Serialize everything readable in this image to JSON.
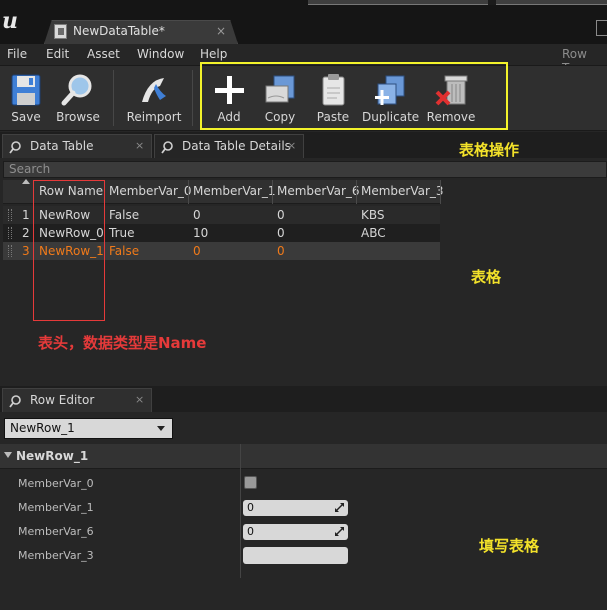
{
  "window": {
    "logo": "u",
    "tab_title": "NewDataTable*",
    "tab_close": "×"
  },
  "menu": {
    "items": [
      "File",
      "Edit",
      "Asset",
      "Window",
      "Help"
    ],
    "right_text": "Row Typ"
  },
  "toolbar": {
    "buttons": [
      {
        "label": "Save",
        "icon": "save-icon"
      },
      {
        "label": "Browse",
        "icon": "browse-icon"
      },
      {
        "label": "Reimport",
        "icon": "reimport-icon"
      },
      {
        "label": "Add",
        "icon": "add-icon"
      },
      {
        "label": "Copy",
        "icon": "copy-icon"
      },
      {
        "label": "Paste",
        "icon": "paste-icon"
      },
      {
        "label": "Duplicate",
        "icon": "duplicate-icon"
      },
      {
        "label": "Remove",
        "icon": "remove-icon"
      }
    ]
  },
  "annotations": {
    "table_ops": "表格操作",
    "table": "表格",
    "header_note": "表头，数据类型是Name",
    "fill_table": "填写表格"
  },
  "panels": {
    "data_table_tab": "Data Table",
    "details_tab": "Data Table Details",
    "row_editor_tab": "Row Editor",
    "close": "×"
  },
  "table": {
    "search_placeholder": "Search",
    "columns": [
      "Row Name",
      "MemberVar_0",
      "MemberVar_1",
      "MemberVar_6",
      "MemberVar_3"
    ],
    "rows": [
      {
        "index": "1",
        "cells": [
          "NewRow",
          "False",
          "0",
          "0",
          "KBS"
        ]
      },
      {
        "index": "2",
        "cells": [
          "NewRow_0",
          "True",
          "10",
          "0",
          "ABC"
        ]
      },
      {
        "index": "3",
        "cells": [
          "NewRow_1",
          "False",
          "0",
          "0",
          ""
        ]
      }
    ],
    "selected_row": 2
  },
  "row_editor": {
    "selected": "NewRow_1",
    "section_title": "NewRow_1",
    "properties": [
      {
        "label": "MemberVar_0",
        "type": "checkbox",
        "value": ""
      },
      {
        "label": "MemberVar_1",
        "type": "number",
        "value": "0"
      },
      {
        "label": "MemberVar_6",
        "type": "number",
        "value": "0"
      },
      {
        "label": "MemberVar_3",
        "type": "text",
        "value": ""
      }
    ]
  },
  "colors": {
    "annotation_yellow": "#f3e22a",
    "annotation_red": "#e53a3a",
    "selected_row_text": "#f07a1a"
  }
}
